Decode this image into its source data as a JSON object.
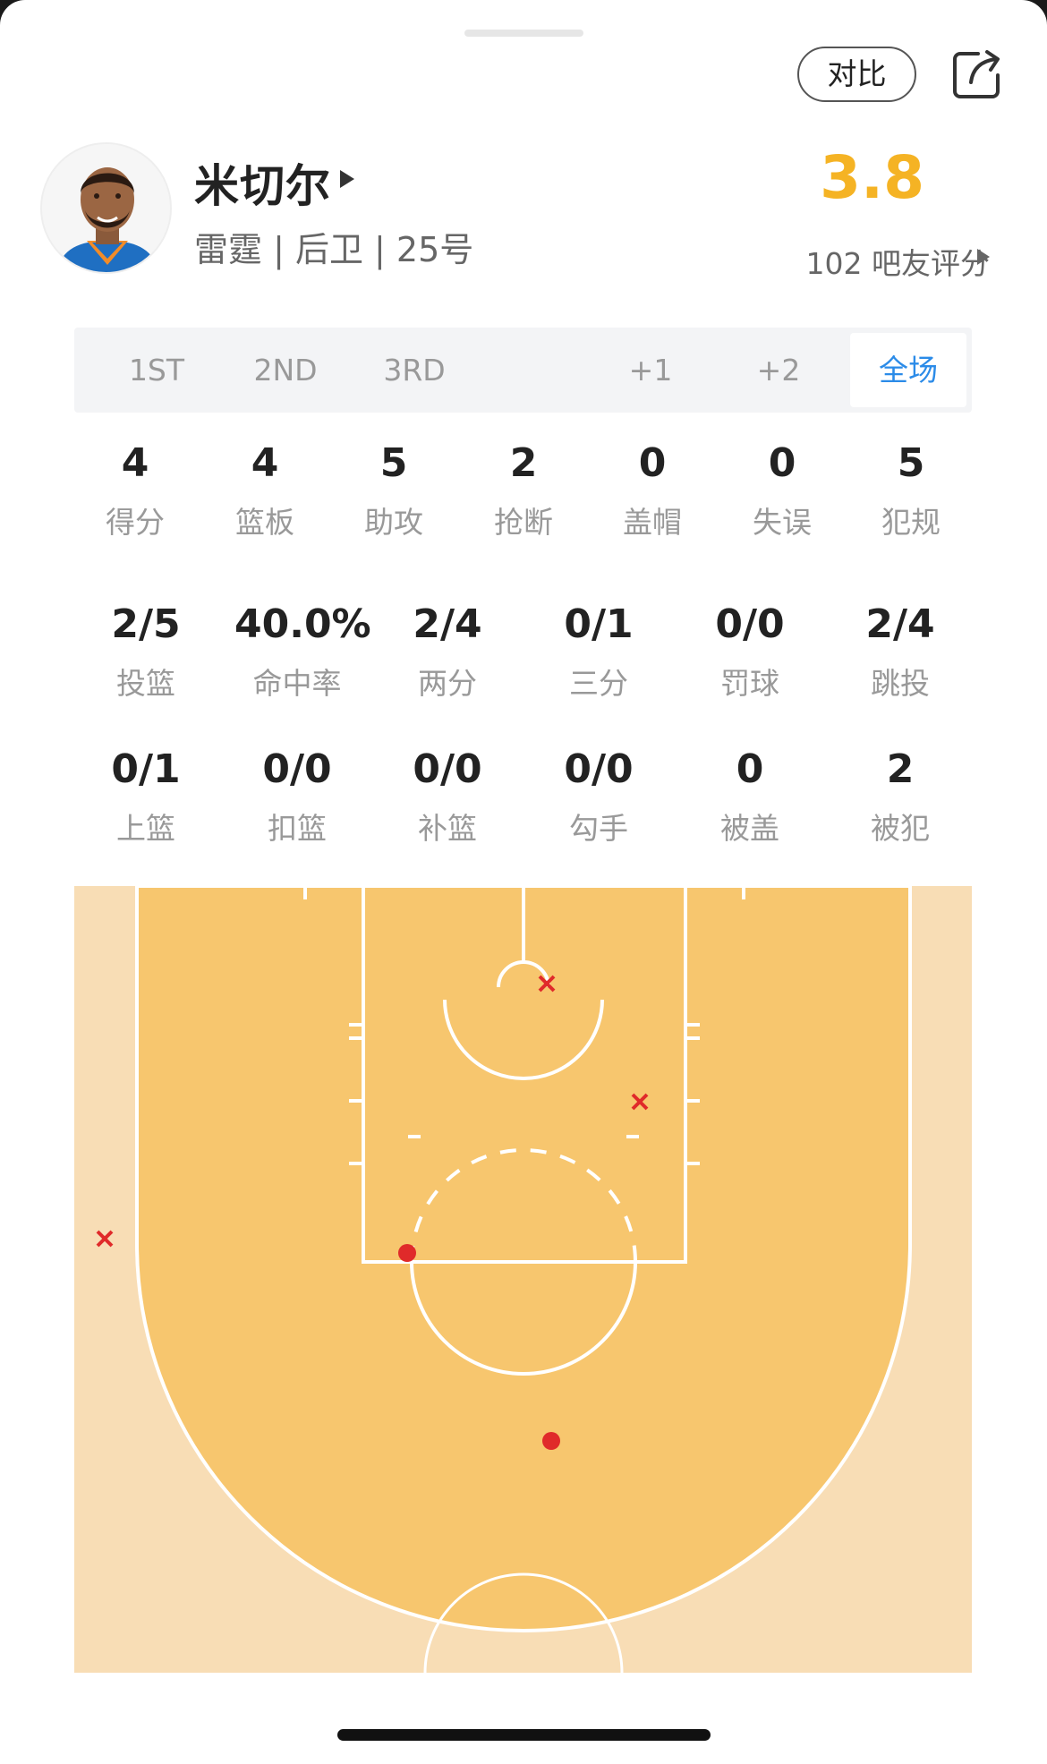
{
  "header": {
    "compare_label": "对比",
    "share_icon": "share-icon"
  },
  "player": {
    "name": "米切尔",
    "meta": "雷霆 | 后卫 | 25号",
    "rating": "3.8",
    "rating_count": "102 吧友评分"
  },
  "tabs": [
    {
      "label": "1ST"
    },
    {
      "label": "2ND"
    },
    {
      "label": "3RD"
    },
    {
      "label": "+1"
    },
    {
      "label": "+2"
    },
    {
      "label": "全场",
      "active": true
    }
  ],
  "stats_row1": [
    {
      "value": "4",
      "label": "得分"
    },
    {
      "value": "4",
      "label": "篮板"
    },
    {
      "value": "5",
      "label": "助攻"
    },
    {
      "value": "2",
      "label": "抢断"
    },
    {
      "value": "0",
      "label": "盖帽"
    },
    {
      "value": "0",
      "label": "失误"
    },
    {
      "value": "5",
      "label": "犯规"
    }
  ],
  "stats_row2": [
    {
      "value": "2/5",
      "label": "投篮"
    },
    {
      "value": "40.0%",
      "label": "命中率"
    },
    {
      "value": "2/4",
      "label": "两分"
    },
    {
      "value": "0/1",
      "label": "三分"
    },
    {
      "value": "0/0",
      "label": "罚球"
    },
    {
      "value": "2/4",
      "label": "跳投"
    }
  ],
  "stats_row3": [
    {
      "value": "0/1",
      "label": "上篮"
    },
    {
      "value": "0/0",
      "label": "扣篮"
    },
    {
      "value": "0/0",
      "label": "补篮"
    },
    {
      "value": "0/0",
      "label": "勾手"
    },
    {
      "value": "0",
      "label": "被盖"
    },
    {
      "value": "2",
      "label": "被犯"
    }
  ],
  "colors": {
    "accent": "#2b8be8",
    "rating": "#f5b324",
    "court_inner": "#f7c66e",
    "court_outer": "#f8ddb5",
    "made": "#e02a2a",
    "missed": "#e02a2a"
  }
}
